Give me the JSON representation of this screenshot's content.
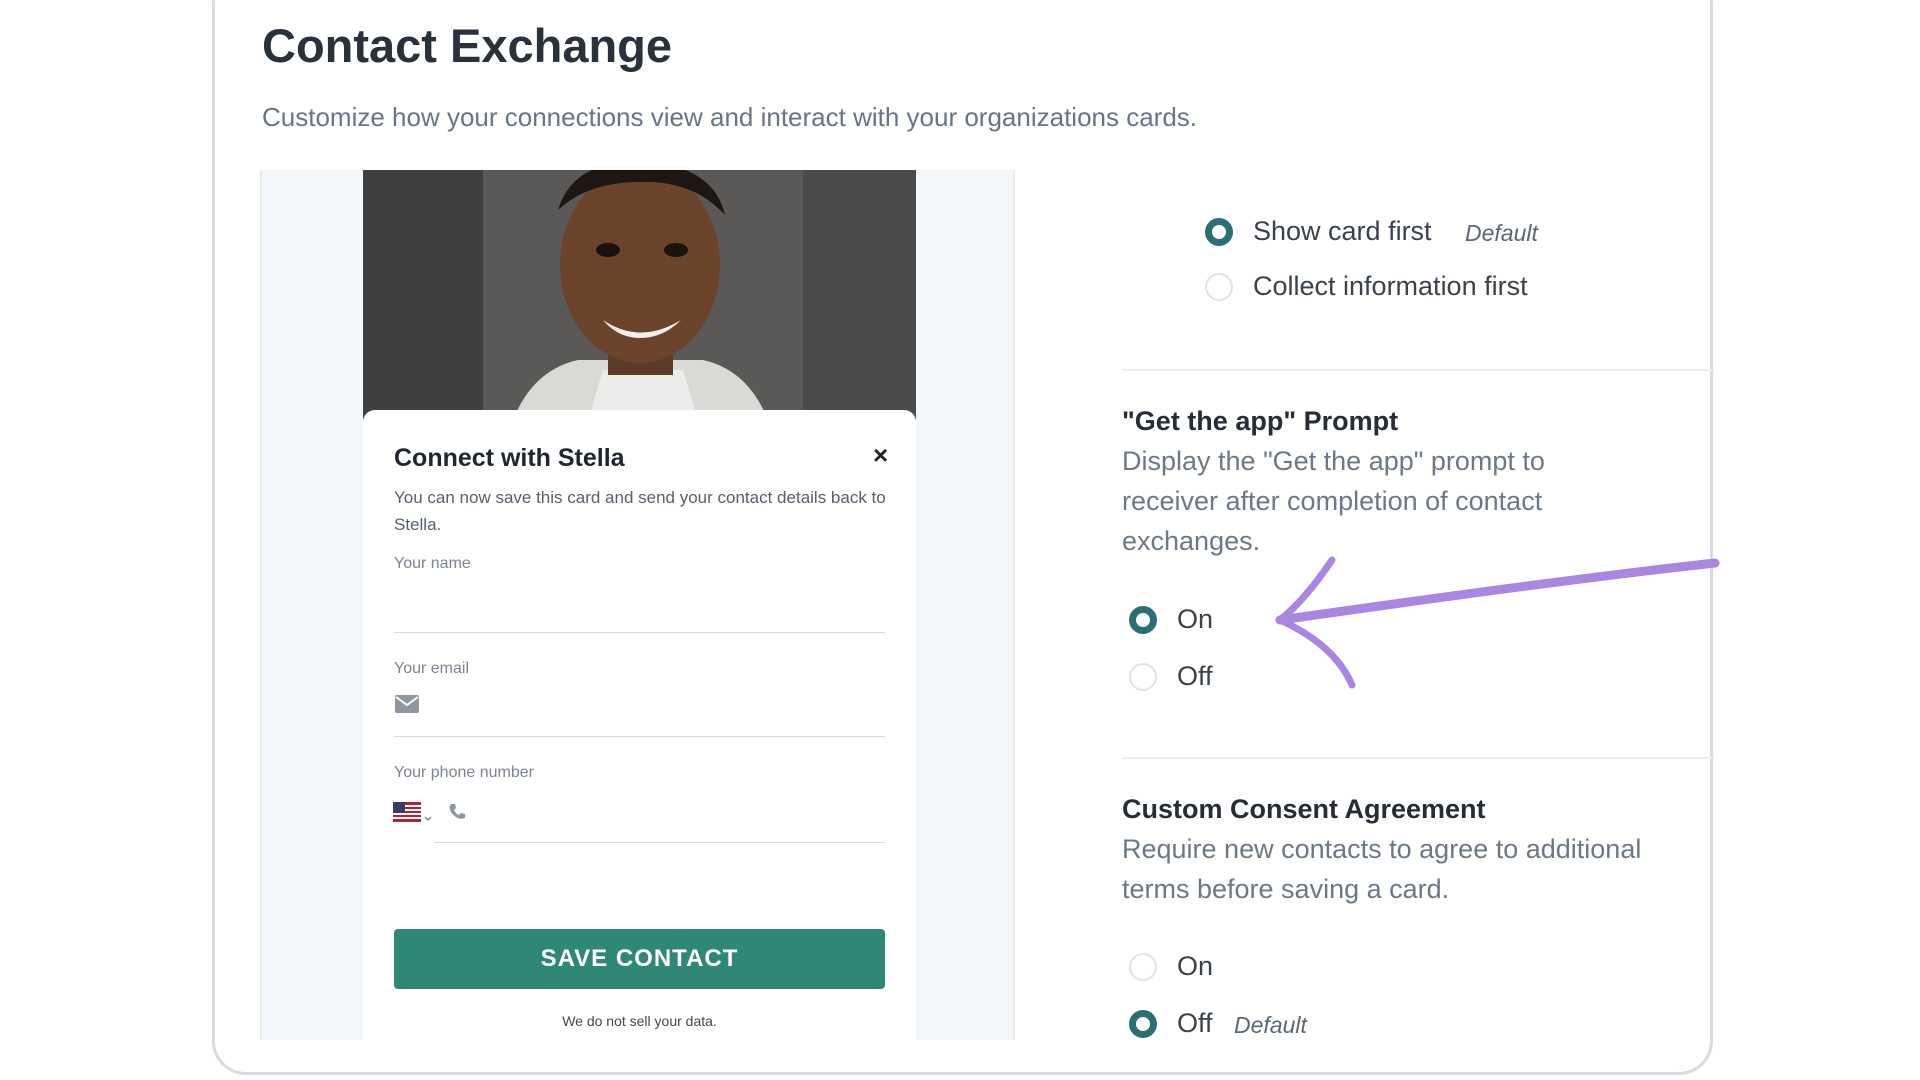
{
  "header": {
    "title": "Contact Exchange",
    "subtitle": "Customize how your connections view and interact with your organizations cards."
  },
  "preview": {
    "card_title": "Connect with Stella",
    "close_glyph": "×",
    "description": "You can now save this card and send your contact details back to Stella.",
    "name_label": "Your name",
    "email_label": "Your email",
    "phone_label": "Your phone number",
    "country": "US",
    "save_label": "SAVE CONTACT",
    "disclaimer": "We do not sell your data."
  },
  "card_order": {
    "options": [
      {
        "label": "Show card first",
        "selected": true,
        "tag": "Default"
      },
      {
        "label": "Collect information first",
        "selected": false,
        "tag": ""
      }
    ]
  },
  "app_prompt": {
    "title": "\"Get the app\" Prompt",
    "description": "Display the \"Get the app\" prompt to receiver after completion of contact exchanges.",
    "options": [
      {
        "label": "On",
        "selected": true,
        "tag": ""
      },
      {
        "label": "Off",
        "selected": false,
        "tag": ""
      }
    ]
  },
  "consent": {
    "title": "Custom Consent Agreement",
    "description": "Require new contacts to agree to additional terms before saving a card.",
    "options": [
      {
        "label": "On",
        "selected": false,
        "tag": ""
      },
      {
        "label": "Off",
        "selected": true,
        "tag": "Default"
      }
    ]
  },
  "colors": {
    "accent": "#2c6f73",
    "button": "#2f8876",
    "annotation_arrow": "#a987e0"
  },
  "icons": [
    "close-icon",
    "mail-icon",
    "us-flag-icon",
    "chevron-down-icon",
    "phone-icon",
    "arrow-annotation-icon"
  ]
}
